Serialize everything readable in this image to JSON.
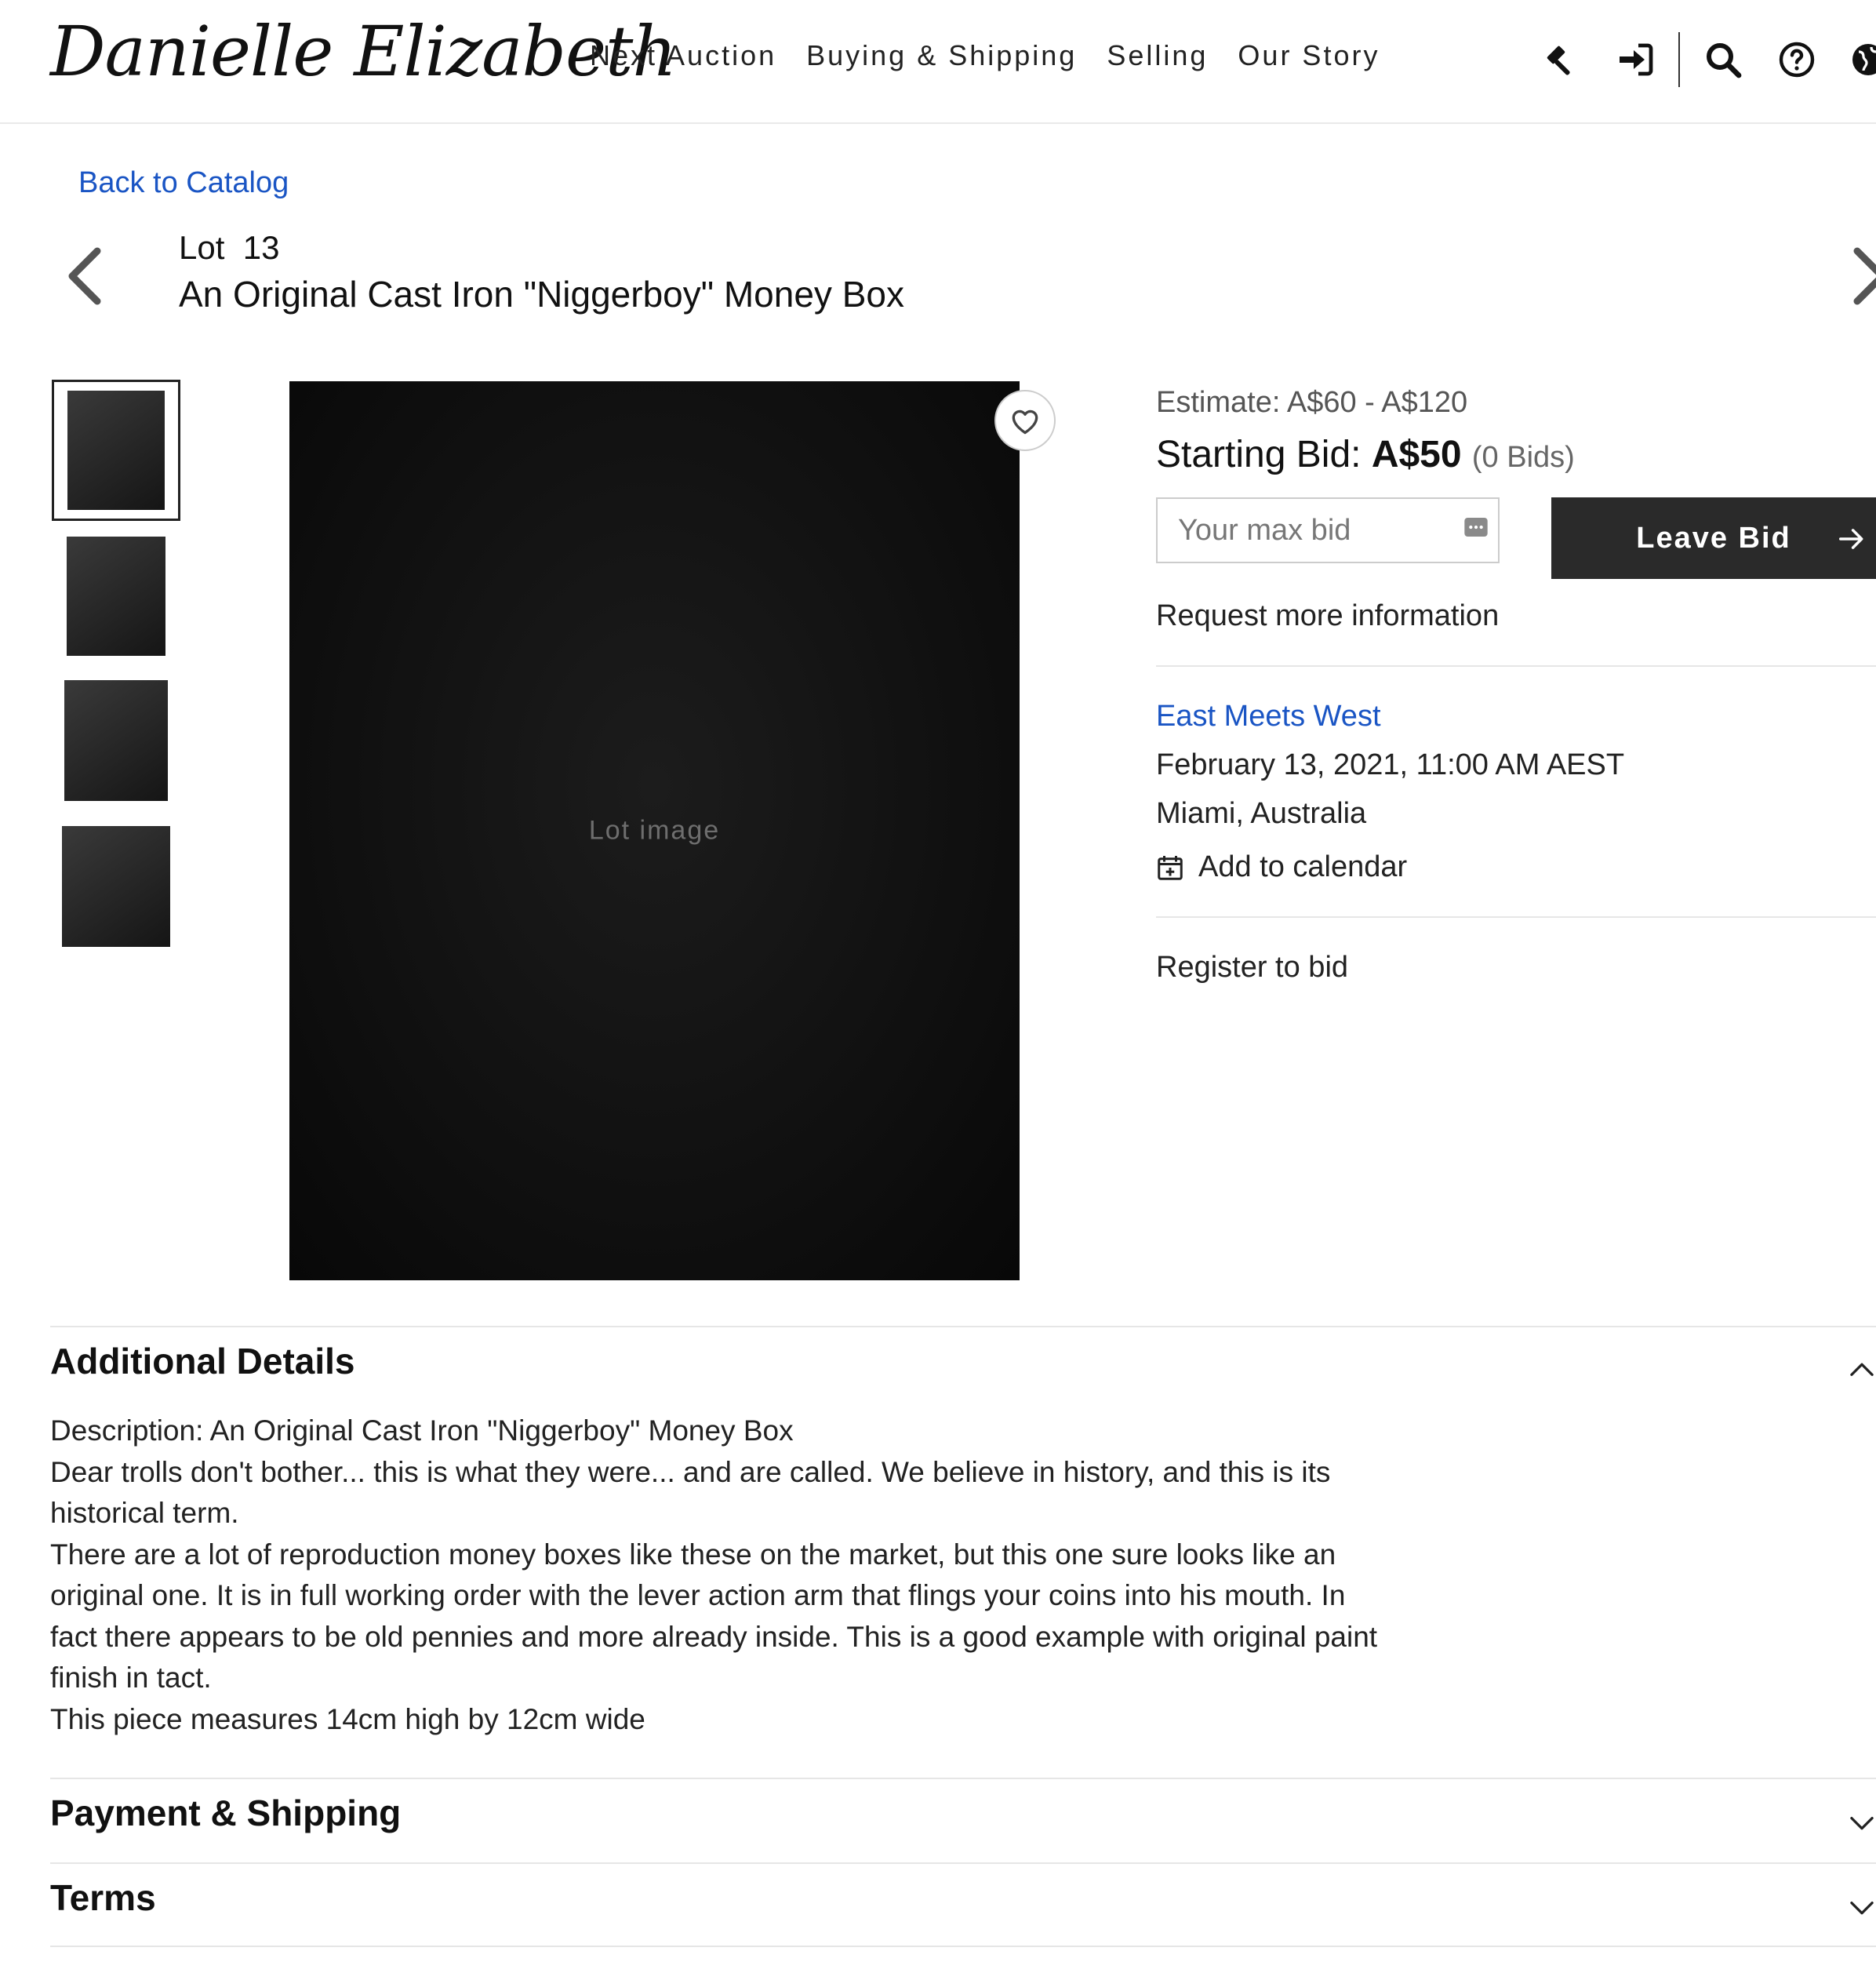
{
  "header": {
    "logo": "Danielle Elizabeth",
    "nav": [
      "Next Auction",
      "Buying & Shipping",
      "Selling",
      "Our Story"
    ],
    "icons": [
      "gavel-icon",
      "sign-in-icon",
      "search-icon",
      "help-icon",
      "globe-icon"
    ]
  },
  "back_link": "Back to Catalog",
  "lot": {
    "number": "Lot  13",
    "title": "An Original Cast Iron \"Niggerboy\" Money Box"
  },
  "image": {
    "placeholder": "Lot image"
  },
  "bidding": {
    "estimate": "Estimate: A$60 - A$120",
    "starting_label": "Starting Bid: ",
    "starting_amount": "A$50",
    "bids_count": "(0 Bids)",
    "max_bid_placeholder": "Your max bid",
    "leave_bid_label": "Leave Bid",
    "request_info": "Request more information"
  },
  "auction": {
    "name": "East Meets West",
    "datetime": "February 13, 2021, 11:00 AM AEST",
    "location": "Miami, Australia",
    "add_to_calendar": "Add to calendar",
    "register": "Register to bid"
  },
  "sections": {
    "additional_details": {
      "title": "Additional Details",
      "lines": [
        "Description: An Original Cast Iron \"Niggerboy\" Money Box",
        "Dear trolls don't bother... this is what they were... and are called. We believe in history, and this is its historical term.",
        "There are a lot of reproduction money boxes like these on the market, but this one sure looks like an original one. It is in full working order with the lever action arm that flings your coins into his mouth. In fact there appears to be old pennies and more already inside. This is a good example with original paint finish in tact.",
        "This piece measures 14cm high by 12cm wide"
      ]
    },
    "payment_shipping": {
      "title": "Payment & Shipping"
    },
    "terms": {
      "title": "Terms"
    }
  },
  "colors": {
    "link": "#1a55c4",
    "button_bg": "#2a2a2a",
    "divider": "#e6e6e6"
  }
}
